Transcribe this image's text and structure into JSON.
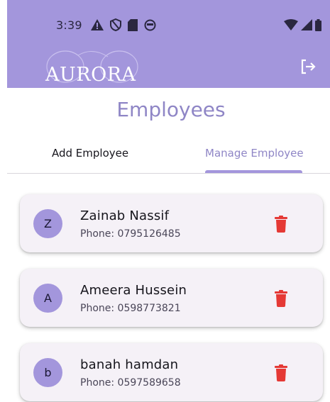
{
  "status_bar": {
    "time": "3:39",
    "icons": [
      "alert-icon",
      "shield-icon",
      "sd-card-icon",
      "vpn-icon",
      "wifi-icon",
      "signal-icon",
      "battery-icon"
    ]
  },
  "header": {
    "logo_text": "AURORA",
    "logout_icon": "logout-icon"
  },
  "page": {
    "title": "Employees"
  },
  "tabs": [
    {
      "label": "Add Employee",
      "selected": false
    },
    {
      "label": "Manage Employee",
      "selected": true
    }
  ],
  "employees": [
    {
      "initial": "Z",
      "name": "Zainab Nassif",
      "phone": "Phone: 0795126485"
    },
    {
      "initial": "A",
      "name": "Ameera Hussein",
      "phone": "Phone: 0598773821"
    },
    {
      "initial": "b",
      "name": "banah hamdan",
      "phone": "Phone: 0597589658"
    }
  ],
  "colors": {
    "primary": "#a396dc",
    "title": "#8f86c6",
    "delete": "#e53935",
    "card_bg": "#f5f1f7"
  }
}
